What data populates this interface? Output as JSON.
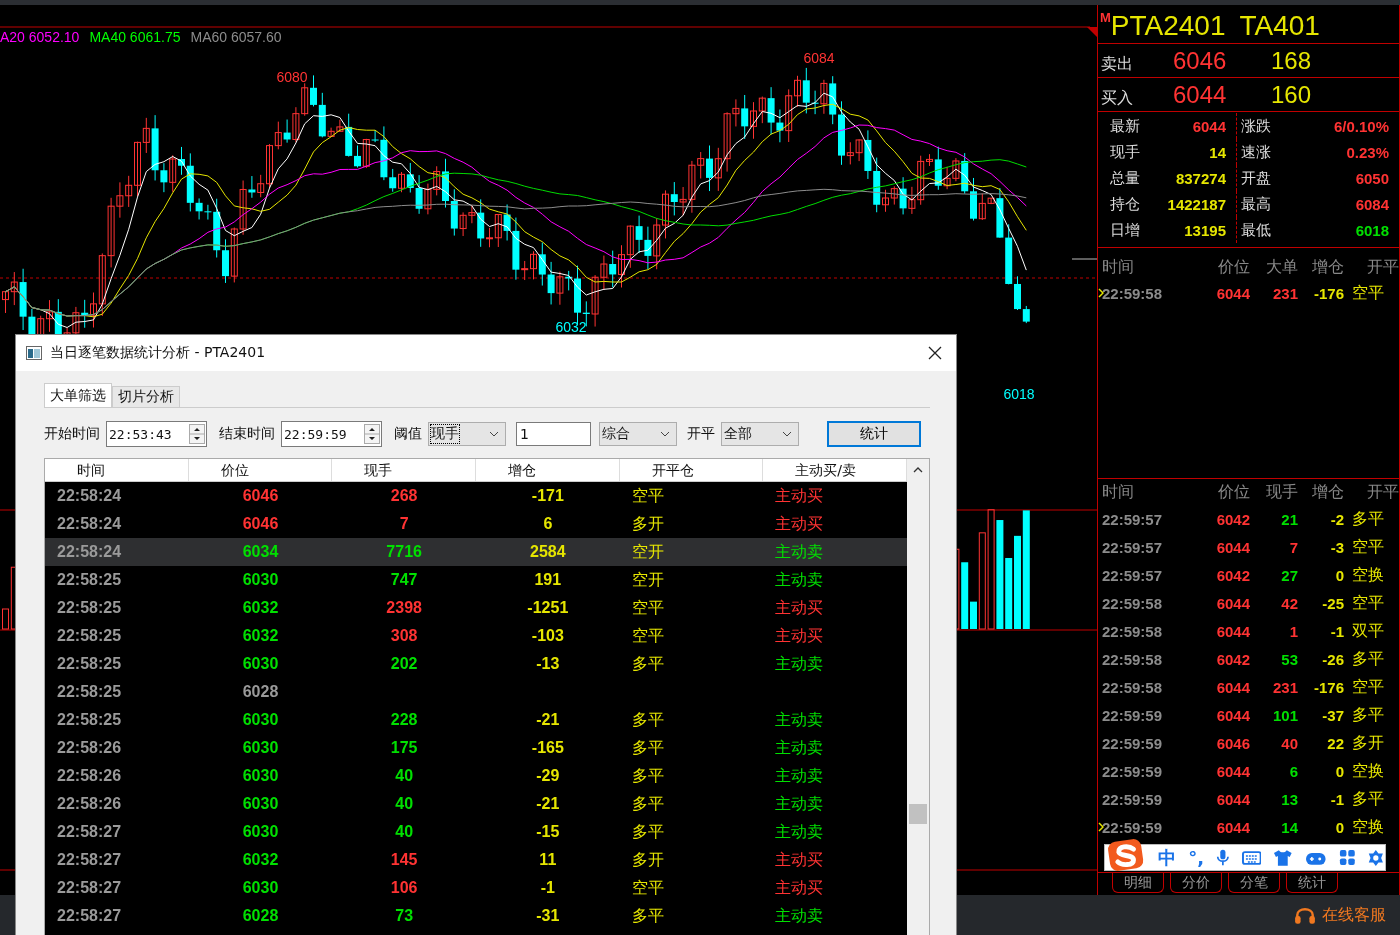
{
  "chart": {
    "legend": [
      {
        "text": "A20 6052.10",
        "color": "#ff00ff"
      },
      {
        "text": "MA40 6061.75",
        "color": "#00ff00"
      },
      {
        "text": "MA60 6057.60",
        "color": "#8c8c8c"
      }
    ],
    "price_labels": [
      {
        "text": "6080",
        "kind": "high"
      },
      {
        "text": "6084",
        "kind": "high"
      },
      {
        "text": "6032",
        "kind": "low"
      },
      {
        "text": "6018",
        "kind": "low"
      }
    ]
  },
  "quote": {
    "flag": "M",
    "code": "PTA2401",
    "short_code": "TA401",
    "book": [
      {
        "label": "卖出",
        "price": "6046",
        "volume": "168"
      },
      {
        "label": "买入",
        "price": "6044",
        "volume": "160"
      }
    ],
    "stats": [
      {
        "label": "最新",
        "value": "6044",
        "color": "#ff3333"
      },
      {
        "label": "涨跌",
        "value": "6/0.10%",
        "color": "#ff3333"
      },
      {
        "label": "现手",
        "value": "14",
        "color": "#e6e600"
      },
      {
        "label": "速涨",
        "value": "0.23%",
        "color": "#ff3333"
      },
      {
        "label": "总量",
        "value": "837274",
        "color": "#e6e600"
      },
      {
        "label": "开盘",
        "value": "6050",
        "color": "#ff3333"
      },
      {
        "label": "持仓",
        "value": "1422187",
        "color": "#e6e600"
      },
      {
        "label": "最高",
        "value": "6084",
        "color": "#ff3333"
      },
      {
        "label": "日增",
        "value": "13195",
        "color": "#e6e600"
      },
      {
        "label": "最低",
        "value": "6018",
        "color": "#00e000"
      }
    ]
  },
  "big_orders": {
    "columns": [
      "时间",
      "价位",
      "大单",
      "增仓",
      "开平"
    ],
    "rows": [
      {
        "time": "22:59:58",
        "price": "6044",
        "volume": "231",
        "buy": true,
        "change": "-176",
        "type": "空平",
        "selected": true
      }
    ]
  },
  "ticks": {
    "columns": [
      "时间",
      "价位",
      "现手",
      "增仓",
      "开平"
    ],
    "rows": [
      {
        "time": "22:59:57",
        "price": "6042",
        "volume": "21",
        "buy": false,
        "change": "-2",
        "type": "多平",
        "selected": false
      },
      {
        "time": "22:59:57",
        "price": "6044",
        "volume": "7",
        "buy": true,
        "change": "-3",
        "type": "空平",
        "selected": false
      },
      {
        "time": "22:59:57",
        "price": "6042",
        "volume": "27",
        "buy": false,
        "change": "0",
        "type": "空换",
        "selected": false
      },
      {
        "time": "22:59:58",
        "price": "6044",
        "volume": "42",
        "buy": true,
        "change": "-25",
        "type": "空平",
        "selected": false
      },
      {
        "time": "22:59:58",
        "price": "6044",
        "volume": "1",
        "buy": true,
        "change": "-1",
        "type": "双平",
        "selected": false
      },
      {
        "time": "22:59:58",
        "price": "6042",
        "volume": "53",
        "buy": false,
        "change": "-26",
        "type": "多平",
        "selected": false
      },
      {
        "time": "22:59:58",
        "price": "6044",
        "volume": "231",
        "buy": true,
        "change": "-176",
        "type": "空平",
        "selected": false
      },
      {
        "time": "22:59:59",
        "price": "6044",
        "volume": "101",
        "buy": false,
        "change": "-37",
        "type": "多平",
        "selected": false
      },
      {
        "time": "22:59:59",
        "price": "6046",
        "volume": "40",
        "buy": true,
        "change": "22",
        "type": "多开",
        "selected": false
      },
      {
        "time": "22:59:59",
        "price": "6044",
        "volume": "6",
        "buy": false,
        "change": "0",
        "type": "空换",
        "selected": false
      },
      {
        "time": "22:59:59",
        "price": "6044",
        "volume": "13",
        "buy": false,
        "change": "-1",
        "type": "多平",
        "selected": false
      },
      {
        "time": "22:59:59",
        "price": "6044",
        "volume": "14",
        "buy": false,
        "change": "0",
        "type": "空换",
        "selected": true
      }
    ]
  },
  "ime_bar": {
    "language": "中",
    "punctuation": "°,"
  },
  "panel_tabs": [
    {
      "label": "明细",
      "selected": false
    },
    {
      "label": "分价",
      "selected": false
    },
    {
      "label": "分笔",
      "selected": false
    },
    {
      "label": "统计",
      "selected": false
    }
  ],
  "support": "在线客服",
  "dialog": {
    "title": "当日逐笔数据统计分析 - PTA2401",
    "tabs": [
      {
        "label": "大单筛选",
        "selected": true
      },
      {
        "label": "切片分析",
        "selected": false
      }
    ],
    "filters": {
      "start_label": "开始时间",
      "start_value": "22:53:43",
      "end_label": "结束时间",
      "end_value": "22:59:59",
      "threshold_label": "阈值",
      "threshold_select": "现手",
      "threshold_value": "1",
      "mode_select": "综合",
      "open_close_label": "开平",
      "open_close_select": "全部",
      "submit": "统计"
    },
    "columns": [
      "时间",
      "价位",
      "现手",
      "增仓",
      "开平仓",
      "主动买/卖"
    ],
    "rows": [
      {
        "kind": "trade",
        "time": "22:58:24",
        "price": "6046",
        "price_up": true,
        "volume": "268",
        "change": "-171",
        "open_close": "空平",
        "initiative": "主动买",
        "buy": true,
        "selected": false
      },
      {
        "kind": "trade",
        "time": "22:58:24",
        "price": "6046",
        "price_up": true,
        "volume": "7",
        "change": "6",
        "open_close": "多开",
        "initiative": "主动买",
        "buy": true,
        "selected": false
      },
      {
        "kind": "trade",
        "time": "22:58:24",
        "price": "6034",
        "price_up": false,
        "volume": "7716",
        "change": "2584",
        "open_close": "空开",
        "initiative": "主动卖",
        "buy": false,
        "selected": true
      },
      {
        "kind": "trade",
        "time": "22:58:25",
        "price": "6030",
        "price_up": false,
        "volume": "747",
        "change": "191",
        "open_close": "空开",
        "initiative": "主动卖",
        "buy": false,
        "selected": false
      },
      {
        "kind": "trade",
        "time": "22:58:25",
        "price": "6032",
        "price_up": false,
        "volume": "2398",
        "change": "-1251",
        "open_close": "空平",
        "initiative": "主动买",
        "buy": true,
        "selected": false
      },
      {
        "kind": "trade",
        "time": "22:58:25",
        "price": "6032",
        "price_up": false,
        "volume": "308",
        "change": "-103",
        "open_close": "空平",
        "initiative": "主动买",
        "buy": true,
        "selected": false
      },
      {
        "kind": "trade",
        "time": "22:58:25",
        "price": "6030",
        "price_up": false,
        "volume": "202",
        "change": "-13",
        "open_close": "多平",
        "initiative": "主动卖",
        "buy": false,
        "selected": false
      },
      {
        "kind": "price_only",
        "time": "22:58:25",
        "price": "6028",
        "selected": false
      },
      {
        "kind": "trade",
        "time": "22:58:25",
        "price": "6030",
        "price_up": false,
        "volume": "228",
        "change": "-21",
        "open_close": "多平",
        "initiative": "主动卖",
        "buy": false,
        "selected": false
      },
      {
        "kind": "trade",
        "time": "22:58:26",
        "price": "6030",
        "price_up": false,
        "volume": "175",
        "change": "-165",
        "open_close": "多平",
        "initiative": "主动卖",
        "buy": false,
        "selected": false
      },
      {
        "kind": "trade",
        "time": "22:58:26",
        "price": "6030",
        "price_up": false,
        "volume": "40",
        "change": "-29",
        "open_close": "多平",
        "initiative": "主动卖",
        "buy": false,
        "selected": false
      },
      {
        "kind": "trade",
        "time": "22:58:26",
        "price": "6030",
        "price_up": false,
        "volume": "40",
        "change": "-21",
        "open_close": "多平",
        "initiative": "主动卖",
        "buy": false,
        "selected": false
      },
      {
        "kind": "trade",
        "time": "22:58:27",
        "price": "6030",
        "price_up": false,
        "volume": "40",
        "change": "-15",
        "open_close": "多平",
        "initiative": "主动卖",
        "buy": false,
        "selected": false
      },
      {
        "kind": "trade",
        "time": "22:58:27",
        "price": "6032",
        "price_up": false,
        "volume": "145",
        "change": "11",
        "open_close": "多开",
        "initiative": "主动买",
        "buy": true,
        "selected": false
      },
      {
        "kind": "trade",
        "time": "22:58:27",
        "price": "6030",
        "price_up": false,
        "volume": "106",
        "change": "-1",
        "open_close": "空平",
        "initiative": "主动买",
        "buy": true,
        "selected": false
      },
      {
        "kind": "trade",
        "time": "22:58:27",
        "price": "6028",
        "price_up": false,
        "volume": "73",
        "change": "-31",
        "open_close": "多平",
        "initiative": "主动卖",
        "buy": false,
        "selected": false
      }
    ]
  }
}
